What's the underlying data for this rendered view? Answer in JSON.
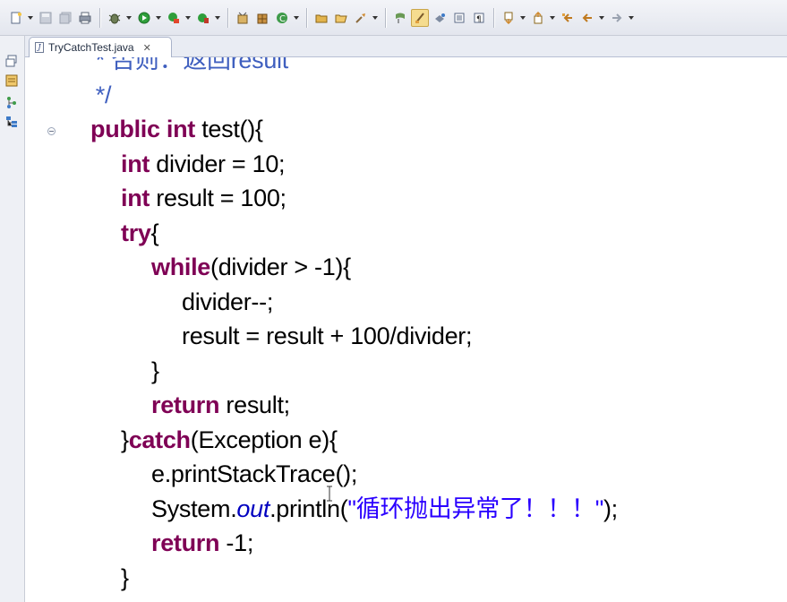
{
  "toolbar": {
    "buttons": [
      {
        "name": "new-icon"
      },
      {
        "name": "save-icon"
      },
      {
        "name": "save-all-icon"
      },
      {
        "name": "print-icon"
      },
      {
        "name": "debug-icon"
      },
      {
        "name": "run-icon"
      },
      {
        "name": "run-coverage-icon"
      },
      {
        "name": "external-tools-icon"
      },
      {
        "name": "new-java-project-icon"
      },
      {
        "name": "new-package-icon"
      },
      {
        "name": "new-class-icon"
      },
      {
        "name": "open-type-icon"
      },
      {
        "name": "open-task-icon"
      },
      {
        "name": "search-icon"
      },
      {
        "name": "toggle-breadcrumb-icon"
      },
      {
        "name": "mark-occurrences-icon"
      },
      {
        "name": "block-selection-icon"
      },
      {
        "name": "show-whitespace-icon"
      },
      {
        "name": "next-annotation-icon"
      },
      {
        "name": "previous-annotation-icon"
      },
      {
        "name": "last-edit-location-icon"
      },
      {
        "name": "back-icon"
      },
      {
        "name": "forward-icon"
      }
    ]
  },
  "sidebar": {
    "icons": [
      "restore-icon",
      "package-explorer-icon",
      "hierarchy-icon",
      "outline-icon"
    ]
  },
  "editor": {
    "tab": {
      "label": "TryCatchTest.java",
      "close": "✕"
    },
    "code_lines": [
      {
        "indent": 0,
        "tokens": [
          {
            "t": "    * 否则：返回result",
            "k": "comment"
          }
        ]
      },
      {
        "indent": 0,
        "tokens": [
          {
            "t": "    */",
            "k": "comment"
          }
        ]
      },
      {
        "indent": 0,
        "tokens": [
          {
            "t": "public",
            "k": "kw"
          },
          {
            "t": " ",
            "k": ""
          },
          {
            "t": "int",
            "k": "kw"
          },
          {
            "t": " test(){",
            "k": ""
          }
        ]
      },
      {
        "indent": 1,
        "tokens": [
          {
            "t": "int",
            "k": "kw"
          },
          {
            "t": " divider = 10;",
            "k": ""
          }
        ]
      },
      {
        "indent": 1,
        "tokens": [
          {
            "t": "int",
            "k": "kw"
          },
          {
            "t": " result = 100;",
            "k": ""
          }
        ]
      },
      {
        "indent": 1,
        "tokens": [
          {
            "t": "try",
            "k": "kw"
          },
          {
            "t": "{",
            "k": ""
          }
        ]
      },
      {
        "indent": 2,
        "tokens": [
          {
            "t": "while",
            "k": "kw"
          },
          {
            "t": "(divider > -1){",
            "k": ""
          }
        ]
      },
      {
        "indent": 3,
        "tokens": [
          {
            "t": "divider--;",
            "k": ""
          }
        ]
      },
      {
        "indent": 3,
        "tokens": [
          {
            "t": "result = result + 100/divider;",
            "k": ""
          }
        ]
      },
      {
        "indent": 2,
        "tokens": [
          {
            "t": "}",
            "k": ""
          }
        ]
      },
      {
        "indent": 2,
        "tokens": [
          {
            "t": "return",
            "k": "kw"
          },
          {
            "t": " result;",
            "k": ""
          }
        ]
      },
      {
        "indent": 1,
        "tokens": [
          {
            "t": "}",
            "k": ""
          },
          {
            "t": "catch",
            "k": "kw"
          },
          {
            "t": "(Exception e){",
            "k": ""
          }
        ]
      },
      {
        "indent": 2,
        "tokens": [
          {
            "t": "e.printStackTrace();",
            "k": ""
          }
        ]
      },
      {
        "indent": 2,
        "tokens": [
          {
            "t": "System.",
            "k": ""
          },
          {
            "t": "out",
            "k": "field"
          },
          {
            "t": ".println(",
            "k": ""
          },
          {
            "t": "\"循环抛出异常了！！！\"",
            "k": "str"
          },
          {
            "t": ");",
            "k": ""
          }
        ]
      },
      {
        "indent": 2,
        "tokens": [
          {
            "t": "return",
            "k": "kw"
          },
          {
            "t": " -1;",
            "k": ""
          }
        ]
      },
      {
        "indent": 1,
        "tokens": [
          {
            "t": "}",
            "k": ""
          }
        ]
      }
    ]
  },
  "colors": {
    "keyword": "#7f0055",
    "comment": "#3f5fbf",
    "string": "#2a00ff",
    "field": "#0000c0",
    "text": "#000000"
  }
}
